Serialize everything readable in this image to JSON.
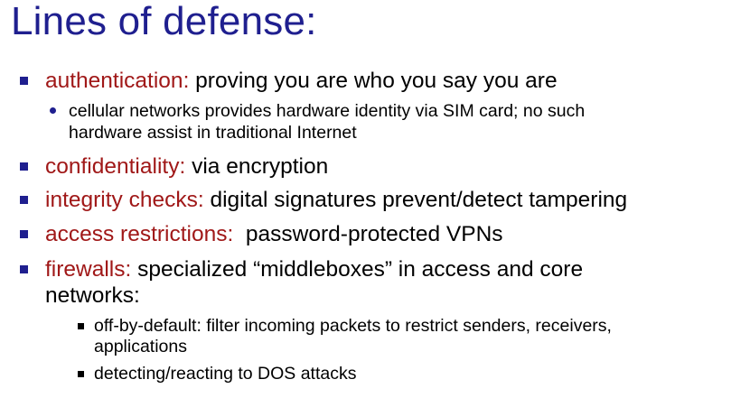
{
  "title": "Lines of defense:",
  "colors": {
    "title": "#1f1f8f",
    "term": "#a01818",
    "bullet": "#1f1f8f",
    "text": "#000000"
  },
  "bullets": [
    {
      "term": "authentication:",
      "text": " proving you are who you say you are",
      "sub": {
        "line1": "cellular networks provides hardware identity via SIM card; no such",
        "line2": "hardware assist in traditional Internet"
      }
    },
    {
      "term": "confidentiality:",
      "text": " via encryption"
    },
    {
      "term": "integrity checks:",
      "text": " digital signatures prevent/detect tampering"
    },
    {
      "term": "access restrictions:",
      "text": "  password-protected VPNs"
    },
    {
      "term": "firewalls:",
      "text": " specialized “middleboxes” in access and core",
      "continuation": "networks:",
      "subitems": [
        {
          "line1": "off-by-default: filter incoming packets to restrict senders, receivers,",
          "line2": "applications"
        },
        {
          "line1": "detecting/reacting to DOS attacks"
        }
      ]
    }
  ]
}
